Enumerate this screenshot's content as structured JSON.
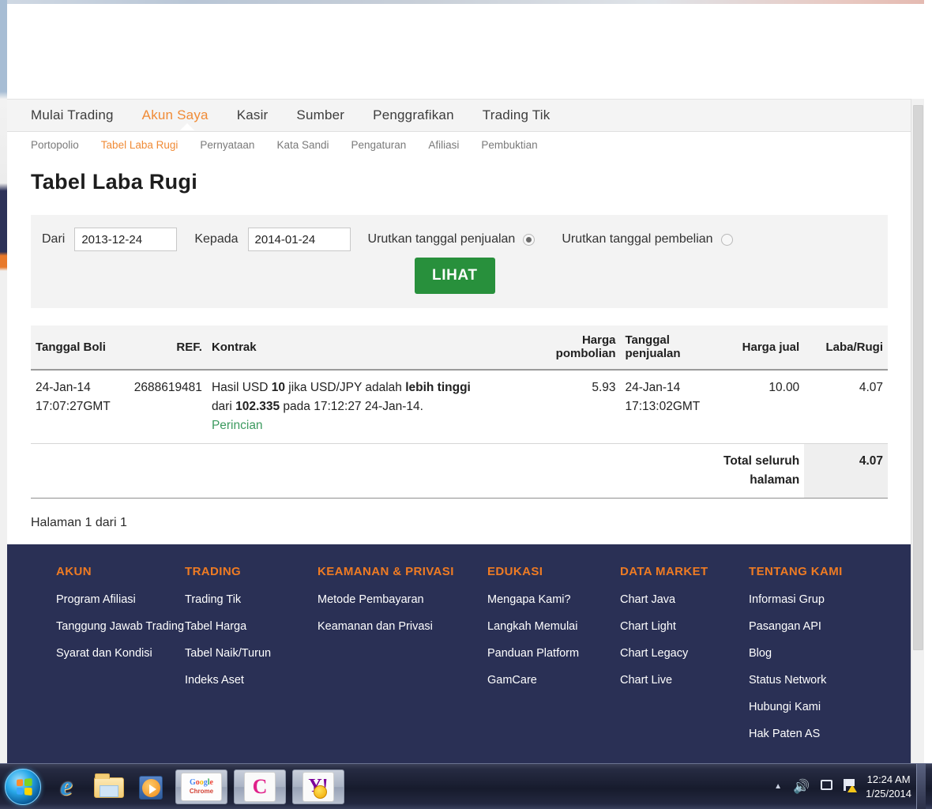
{
  "browser": {
    "scrollbar": {
      "name": "vertical-scrollbar"
    }
  },
  "mainnav": {
    "items": [
      {
        "label": "Mulai Trading",
        "active": false
      },
      {
        "label": "Akun Saya",
        "active": true
      },
      {
        "label": "Kasir",
        "active": false
      },
      {
        "label": "Sumber",
        "active": false
      },
      {
        "label": "Penggrafikan",
        "active": false
      },
      {
        "label": "Trading Tik",
        "active": false
      }
    ]
  },
  "subnav": {
    "items": [
      {
        "label": "Portopolio",
        "active": false
      },
      {
        "label": "Tabel Laba Rugi",
        "active": true
      },
      {
        "label": "Pernyataan",
        "active": false
      },
      {
        "label": "Kata Sandi",
        "active": false
      },
      {
        "label": "Pengaturan",
        "active": false
      },
      {
        "label": "Afiliasi",
        "active": false
      },
      {
        "label": "Pembuktian",
        "active": false
      }
    ]
  },
  "page": {
    "title": "Tabel Laba Rugi",
    "pagination": "Halaman 1 dari 1"
  },
  "filter": {
    "from_label": "Dari",
    "from_value": "2013-12-24",
    "to_label": "Kepada",
    "to_value": "2014-01-24",
    "sort_sell_label": "Urutkan tanggal penjualan",
    "sort_buy_label": "Urutkan tanggal pembelian",
    "sort_sell_selected": true,
    "sort_buy_selected": false,
    "submit_label": "LIHAT",
    "submit_color": "#28903c"
  },
  "table": {
    "headers": {
      "buy_date": "Tanggal Boli",
      "ref": "REF.",
      "contract": "Kontrak",
      "buy_price": "Harga pombolian",
      "sell_date": "Tanggal penjualan",
      "sell_price": "Harga jual",
      "profit_loss": "Laba/Rugi"
    },
    "rows": [
      {
        "buy_date_1": "24-Jan-14",
        "buy_date_2": "17:07:27GMT",
        "ref": "2688619481",
        "contract_1a": "Hasil USD ",
        "contract_1b": "10",
        "contract_1c": " jika USD/JPY adalah ",
        "contract_1d": "lebih tinggi",
        "contract_2a": "dari ",
        "contract_2b": "102.335",
        "contract_2c": " pada 17:12:27 24-Jan-14.",
        "details_link": "Perincian",
        "buy_price": "5.93",
        "sell_date_1": "24-Jan-14",
        "sell_date_2": "17:13:02GMT",
        "sell_price": "10.00",
        "profit_loss": "4.07"
      }
    ],
    "total_label": "Total seluruh halaman",
    "total_value": "4.07"
  },
  "footer": {
    "columns": [
      {
        "heading": "AKUN",
        "links": [
          "Program Afiliasi",
          "Tanggung Jawab Trading",
          "Syarat dan Kondisi"
        ]
      },
      {
        "heading": "TRADING",
        "links": [
          "Trading Tik",
          "Tabel Harga",
          "Tabel Naik/Turun",
          "Indeks Aset"
        ]
      },
      {
        "heading": "KEAMANAN & PRIVASI",
        "links": [
          "Metode Pembayaran",
          "Keamanan dan Privasi"
        ]
      },
      {
        "heading": "EDUKASI",
        "links": [
          "Mengapa Kami?",
          "Langkah Memulai",
          "Panduan Platform",
          "GamCare"
        ]
      },
      {
        "heading": "DATA MARKET",
        "links": [
          "Chart Java",
          "Chart Light",
          "Chart Legacy",
          "Chart Live"
        ]
      },
      {
        "heading": "TENTANG KAMI",
        "links": [
          "Informasi Grup",
          "Pasangan API",
          "Blog",
          "Status Network",
          "Hubungi Kami",
          "Hak Paten AS"
        ]
      }
    ],
    "heading_color": "#ef7b23",
    "background_color": "#2a3055"
  },
  "taskbar": {
    "start_label": "Start",
    "items": [
      {
        "name": "internet-explorer",
        "label": "Internet Explorer"
      },
      {
        "name": "windows-explorer",
        "label": "Windows Explorer"
      },
      {
        "name": "windows-media-player",
        "label": "Windows Media Player"
      }
    ],
    "windows": [
      {
        "name": "google-chrome",
        "g1": "G",
        "g2": "o",
        "g3": "o",
        "g4": "g",
        "g5": "l",
        "g6": "e",
        "sub": "Chrome"
      },
      {
        "name": "camtasia",
        "glyph": "C"
      },
      {
        "name": "yahoo-messenger",
        "glyph": "Y!"
      }
    ],
    "tray": {
      "time": "12:24 AM",
      "date": "1/25/2014"
    }
  }
}
